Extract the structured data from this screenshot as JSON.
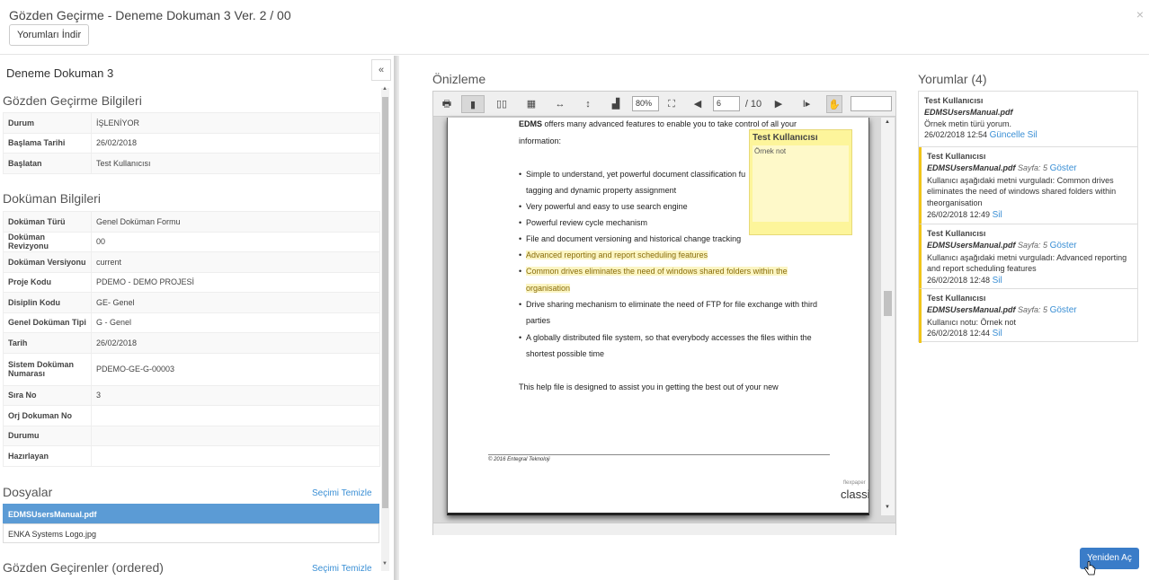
{
  "header": {
    "title": "Gözden Geçirme - Deneme Dokuman 3 Ver. 2 / 00",
    "close": "×",
    "download_comments": "Yorumları İndir"
  },
  "left": {
    "doc_name": "Deneme Dokuman 3",
    "collapse_icon": "«",
    "review_info": {
      "title": "Gözden Geçirme Bilgileri",
      "rows": [
        {
          "k": "Durum",
          "v": "İŞLENİYOR"
        },
        {
          "k": "Başlama Tarihi",
          "v": "26/02/2018"
        },
        {
          "k": "Başlatan",
          "v": "Test Kullanıcısı"
        }
      ]
    },
    "doc_info": {
      "title": "Doküman Bilgileri",
      "rows": [
        {
          "k": "Doküman Türü",
          "v": "Genel Doküman Formu"
        },
        {
          "k": "Doküman Revizyonu",
          "v": "00"
        },
        {
          "k": "Doküman Versiyonu",
          "v": "current"
        },
        {
          "k": "Proje Kodu",
          "v": "PDEMO - DEMO PROJESİ"
        },
        {
          "k": "Disiplin Kodu",
          "v": "GE- Genel"
        },
        {
          "k": "Genel Doküman Tipi",
          "v": "G - Genel"
        },
        {
          "k": "Tarih",
          "v": "26/02/2018"
        },
        {
          "k": "Sistem Doküman Numarası",
          "v": "PDEMO-GE-G-00003"
        },
        {
          "k": "Sıra No",
          "v": "3"
        },
        {
          "k": "Orj Dokuman No",
          "v": ""
        },
        {
          "k": "Durumu",
          "v": ""
        },
        {
          "k": "Hazırlayan",
          "v": ""
        }
      ]
    },
    "files": {
      "title": "Dosyalar",
      "clear": "Seçimi Temizle",
      "items": [
        "EDMSUsersManual.pdf",
        "ENKA Systems Logo.jpg"
      ]
    },
    "reviewers": {
      "title": "Gözden Geçirenler  (ordered)",
      "clear": "Seçimi Temizle"
    }
  },
  "preview": {
    "title": "Önizleme",
    "zoom": "80%",
    "page": "6",
    "page_total": "/ 10",
    "page_lines": {
      "intro_bold": "EDMS",
      "intro_rest": " offers many advanced features to enable you to take control of all your",
      "intro_2": "information:",
      "b1a": "Simple to understand, yet powerful document classification fu",
      "b1b": "tagging and dynamic property assignment",
      "b2": "Very powerful and easy to use search engine",
      "b3": "Powerful review cycle mechanism",
      "b4": "File and document versioning and historical change tracking",
      "b5": "Advanced reporting and report scheduling features",
      "b6a": "Common drives eliminates the need of windows shared folders within the",
      "b6b": "organisation",
      "b7a": "Drive sharing mechanism to eliminate the need of FTP for file exchange with third",
      "b7b": "parties",
      "b8a": "A globally distributed file system, so that everybody accesses the files within the",
      "b8b": "shortest possible time",
      "closing": "This help file is designed to assist you in getting the best out of your new",
      "footer": "© 2016 Entegral Teknoloji",
      "brand": "classic",
      "brand_small": "flexpaper"
    },
    "note": {
      "author": "Test Kullanıcısı",
      "text": "Örnek not"
    }
  },
  "comments": {
    "title": "Yorumlar (4)",
    "items": [
      {
        "author": "Test Kullanıcısı",
        "file": "EDMSUsersManual.pdf",
        "page": "",
        "show": "",
        "text": "Örnek metin türü yorum.",
        "date": "26/02/2018 12:54",
        "update": "Güncelle",
        "delete": "Sil"
      },
      {
        "author": "Test Kullanıcısı",
        "file": "EDMSUsersManual.pdf",
        "page": "Sayfa: 5",
        "show": "Göster",
        "text": "Kullanıcı aşağıdaki metni vurguladı: Common drives eliminates the need of windows shared folders within theorganisation",
        "date": "26/02/2018 12:49",
        "update": "",
        "delete": "Sil"
      },
      {
        "author": "Test Kullanıcısı",
        "file": "EDMSUsersManual.pdf",
        "page": "Sayfa: 5",
        "show": "Göster",
        "text": "Kullanıcı aşağıdaki metni vurguladı: Advanced reporting and report scheduling features",
        "date": "26/02/2018 12:48",
        "update": "",
        "delete": "Sil"
      },
      {
        "author": "Test Kullanıcısı",
        "file": "EDMSUsersManual.pdf",
        "page": "Sayfa: 5",
        "show": "Göster",
        "text": "Kullanıcı notu: Örnek not",
        "date": "26/02/2018 12:44",
        "update": "",
        "delete": "Sil"
      }
    ]
  },
  "reopen_button": "Yeniden Aç",
  "colors": {
    "primary": "#3a7cc8",
    "highlight": "#fbf5c3",
    "note": "#fdf59b",
    "comment_marker": "#f0c419"
  }
}
